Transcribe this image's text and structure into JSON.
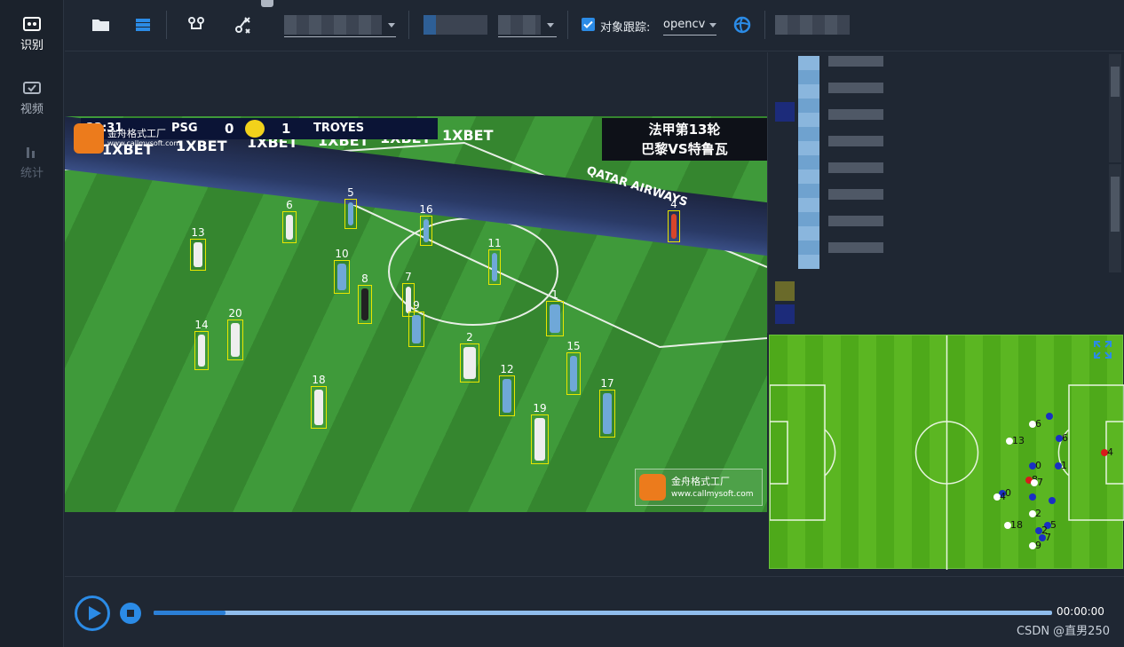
{
  "sidebar": {
    "items": [
      {
        "label": "识别",
        "icon": "recognize-icon",
        "state": "active"
      },
      {
        "label": "视频",
        "icon": "video-icon",
        "state": "normal"
      },
      {
        "label": "统计",
        "icon": "stats-icon",
        "state": "disabled"
      }
    ]
  },
  "toolbar": {
    "icons": [
      "folder-open-icon",
      "layers-icon",
      "route-icon",
      "tactics-icon",
      "track-icon"
    ],
    "tracking_label": "对象跟踪:",
    "tracking_checked": true,
    "tracking_method": "opencv"
  },
  "video": {
    "scoreboard": {
      "home": "PSG",
      "home_score": "0",
      "away_score": "1",
      "away": "TROYES",
      "clock": "23:31"
    },
    "ad_texts": [
      "1XBET",
      "1XBET",
      "1XBET",
      "1XBET",
      "1XBET",
      "1XBET",
      "QATAR AIRWAYS"
    ],
    "title_line1": "法甲第13轮",
    "title_line2": "巴黎VS特鲁瓦",
    "watermark_top_brand": "金舟格式工厂",
    "watermark_top_url": "www.callmysoft.com",
    "watermark_brand": "金舟格式工厂",
    "watermark_url": "www.callmysoft.com",
    "detections": [
      {
        "id": "13",
        "team": "white"
      },
      {
        "id": "6",
        "team": "white"
      },
      {
        "id": "5",
        "team": "blue"
      },
      {
        "id": "16",
        "team": "blue"
      },
      {
        "id": "4",
        "team": "red"
      },
      {
        "id": "10",
        "team": "blue"
      },
      {
        "id": "8",
        "team": "black"
      },
      {
        "id": "7",
        "team": "white"
      },
      {
        "id": "11",
        "team": "blue"
      },
      {
        "id": "1",
        "team": "blue"
      },
      {
        "id": "14",
        "team": "white"
      },
      {
        "id": "20",
        "team": "white"
      },
      {
        "id": "9",
        "team": "blue"
      },
      {
        "id": "2",
        "team": "white"
      },
      {
        "id": "15",
        "team": "blue"
      },
      {
        "id": "12",
        "team": "blue"
      },
      {
        "id": "18",
        "team": "white"
      },
      {
        "id": "17",
        "team": "blue"
      },
      {
        "id": "19",
        "team": "white"
      }
    ]
  },
  "minimap": {
    "expand_icon": "expand-icon",
    "players": [
      {
        "id": "6",
        "team": "white"
      },
      {
        "id": "",
        "team": "blue"
      },
      {
        "id": "6",
        "team": "blue"
      },
      {
        "id": "13",
        "team": "white"
      },
      {
        "id": "0",
        "team": "blue"
      },
      {
        "id": "1",
        "team": "blue"
      },
      {
        "id": "4",
        "team": "red"
      },
      {
        "id": "8",
        "team": "red"
      },
      {
        "id": "7",
        "team": "white"
      },
      {
        "id": "0",
        "team": "blue"
      },
      {
        "id": "4",
        "team": "white"
      },
      {
        "id": "",
        "team": "blue"
      },
      {
        "id": "",
        "team": "blue"
      },
      {
        "id": "2",
        "team": "white"
      },
      {
        "id": "5",
        "team": "blue"
      },
      {
        "id": "18",
        "team": "white"
      },
      {
        "id": "2",
        "team": "blue"
      },
      {
        "id": "7",
        "team": "blue"
      },
      {
        "id": "9",
        "team": "white"
      }
    ]
  },
  "player": {
    "time": "00:00:00",
    "progress": 0.08
  },
  "footer": {
    "watermark": "CSDN @直男250"
  },
  "colors": {
    "accent": "#2b8be6",
    "box": "#e8e600",
    "pitch": "#5bb622"
  }
}
